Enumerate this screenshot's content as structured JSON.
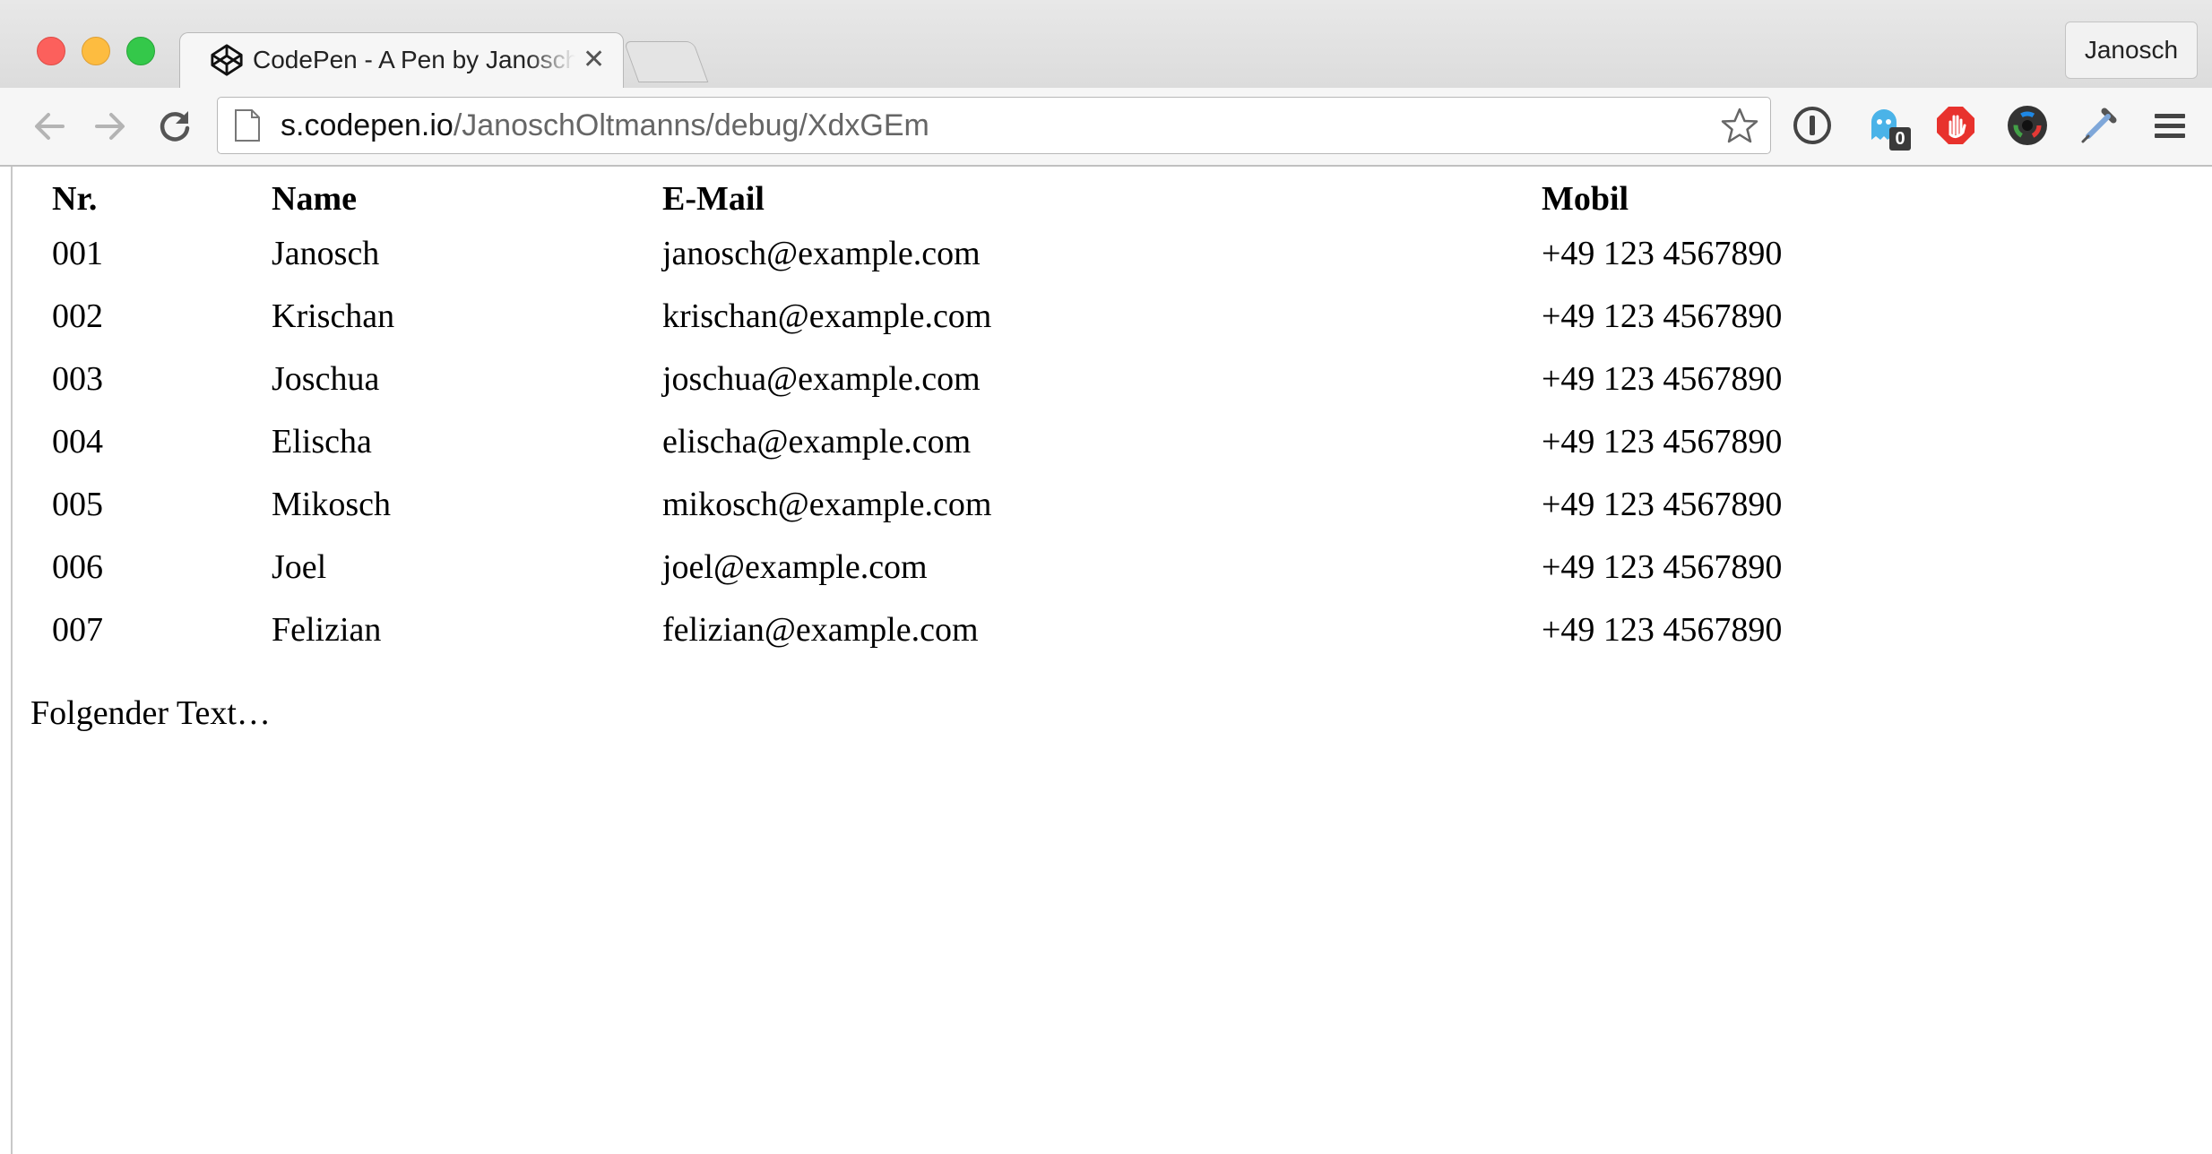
{
  "browser": {
    "tab": {
      "title": "CodePen - A Pen by Janosch Oltmanns",
      "favicon": "codepen-logo-icon"
    },
    "profile_name": "Janosch",
    "address_bar": {
      "host": "s.codepen.io",
      "path": "/JanoschOltmanns/debug/XdxGEm"
    },
    "extensions": [
      {
        "name": "1password-icon"
      },
      {
        "name": "ghostery-icon",
        "badge": "0"
      },
      {
        "name": "adblock-icon"
      },
      {
        "name": "color-wheel-icon"
      },
      {
        "name": "eyedropper-icon"
      }
    ]
  },
  "page": {
    "table": {
      "headers": [
        "Nr.",
        "Name",
        "E-Mail",
        "Mobil"
      ],
      "rows": [
        [
          "001",
          "Janosch",
          "janosch@example.com",
          "+49 123 4567890"
        ],
        [
          "002",
          "Krischan",
          "krischan@example.com",
          "+49 123 4567890"
        ],
        [
          "003",
          "Joschua",
          "joschua@example.com",
          "+49 123 4567890"
        ],
        [
          "004",
          "Elischa",
          "elischa@example.com",
          "+49 123 4567890"
        ],
        [
          "005",
          "Mikosch",
          "mikosch@example.com",
          "+49 123 4567890"
        ],
        [
          "006",
          "Joel",
          "joel@example.com",
          "+49 123 4567890"
        ],
        [
          "007",
          "Felizian",
          "felizian@example.com",
          "+49 123 4567890"
        ]
      ]
    },
    "paragraph": "Folgender Text…"
  },
  "colors": {
    "close": "#fc605c",
    "minimize": "#fdbc40",
    "maximize": "#34c84a",
    "ghostery": "#4ab3e8",
    "adblock": "#e8322d"
  }
}
